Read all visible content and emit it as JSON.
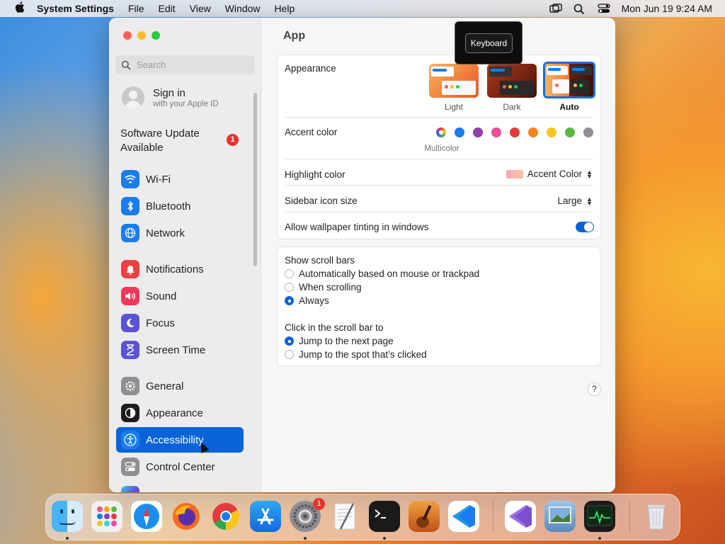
{
  "menubar": {
    "app_name": "System Settings",
    "menus": [
      "File",
      "Edit",
      "View",
      "Window",
      "Help"
    ],
    "clock": "Mon Jun 19  9:24 AM"
  },
  "sidebar": {
    "search_placeholder": "Search",
    "signin": {
      "title": "Sign in",
      "subtitle": "with your Apple ID"
    },
    "software_update": {
      "label": "Software Update Available",
      "badge": "1"
    },
    "items": [
      {
        "label": "Wi-Fi",
        "icon": "wifi-icon",
        "color": "#1a7cf0"
      },
      {
        "label": "Bluetooth",
        "icon": "bluetooth-icon",
        "color": "#1a7cf0"
      },
      {
        "label": "Network",
        "icon": "globe-icon",
        "color": "#1a7cf0"
      },
      {
        "label": "Notifications",
        "icon": "bell-icon",
        "color": "#f04040"
      },
      {
        "label": "Sound",
        "icon": "speaker-icon",
        "color": "#f0385a"
      },
      {
        "label": "Focus",
        "icon": "moon-icon",
        "color": "#5b52d6"
      },
      {
        "label": "Screen Time",
        "icon": "hourglass-icon",
        "color": "#5b52d6"
      },
      {
        "label": "General",
        "icon": "gear-icon",
        "color": "#8e8e93"
      },
      {
        "label": "Appearance",
        "icon": "appearance-icon",
        "color": "#1c1c1e"
      },
      {
        "label": "Accessibility",
        "icon": "accessibility-icon",
        "color": "#1a7cf0"
      },
      {
        "label": "Control Center",
        "icon": "control-center-icon",
        "color": "#8e8e93"
      }
    ]
  },
  "content": {
    "title": "App",
    "tooltip": "Keyboard",
    "appearance": {
      "label": "Appearance",
      "options": [
        {
          "label": "Light"
        },
        {
          "label": "Dark"
        },
        {
          "label": "Auto",
          "selected": true
        }
      ]
    },
    "accent_color": {
      "label": "Accent color",
      "caption": "Multicolor",
      "swatches": [
        "#ffffff",
        "#1a7cf0",
        "#8e3fb1",
        "#ee4a9c",
        "#e33b3b",
        "#f7821b",
        "#f7c51e",
        "#5ab83e",
        "#8e8e93"
      ]
    },
    "highlight_color": {
      "label": "Highlight color",
      "value": "Accent Color"
    },
    "sidebar_icon_size": {
      "label": "Sidebar icon size",
      "value": "Large"
    },
    "wallpaper_tinting": {
      "label": "Allow wallpaper tinting in windows",
      "enabled": true
    },
    "scroll_bars": {
      "label": "Show scroll bars",
      "options": [
        {
          "label": "Automatically based on mouse or trackpad",
          "selected": false
        },
        {
          "label": "When scrolling",
          "selected": false
        },
        {
          "label": "Always",
          "selected": true
        }
      ]
    },
    "click_scroll": {
      "label": "Click in the scroll bar to",
      "options": [
        {
          "label": "Jump to the next page",
          "selected": true
        },
        {
          "label": "Jump to the spot that’s clicked",
          "selected": false
        }
      ]
    },
    "help": "?"
  },
  "dock": {
    "apps": [
      "Finder",
      "Launchpad",
      "Safari",
      "Firefox",
      "Chrome",
      "App Store",
      "System Settings",
      "TextEdit",
      "Terminal",
      "GarageBand",
      "VS Code",
      "Visual Studio",
      "Preview",
      "Activity Monitor",
      "Trash"
    ],
    "settings_badge": "1"
  }
}
